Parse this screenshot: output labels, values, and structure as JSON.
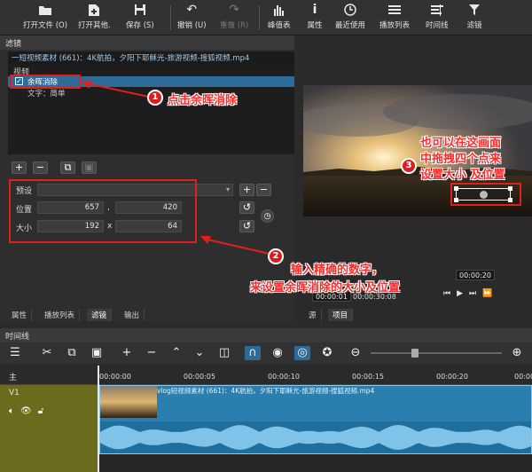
{
  "toolbar": {
    "open_file": "打开文件 (O)",
    "open_other": "打开其他.",
    "save": "保存 (S)",
    "undo": "撤销 (U)",
    "redo": "重做 (R)",
    "peak_meter": "峰值表",
    "properties": "属性",
    "recent": "最近使用",
    "playlist": "播放列表",
    "timeline": "时间线",
    "filters": "滤镜"
  },
  "filters_panel": {
    "title": "滤镜",
    "clip_title": "一短视频素材 (661)：4K航拍，夕阳下耶稣光-旅游视频-搜狐视频.mp4",
    "list_header": "视频",
    "filter_item": "余晖消除",
    "filter_item_checked": true,
    "filter_item2": "文字：简单",
    "preset_label": "预设",
    "position_label": "位置",
    "position_x": "657",
    "position_sep": ",",
    "position_y": "420",
    "size_label": "大小",
    "size_w": "192",
    "size_sep": "x",
    "size_h": "64",
    "tabs": [
      "属性",
      "播放列表",
      "滤镜",
      "输出"
    ]
  },
  "annotations": {
    "one_num": "1",
    "one_text": "点击余晖消除",
    "two_num": "2",
    "two_text_line1": "输入精确的数字，",
    "two_text_line2": "来设置余晖消除的大小及位置",
    "three_num": "3",
    "three_line1": "也可以在这画面",
    "three_line2": "中拖拽四个点来",
    "three_line3": "设置大小 及位置"
  },
  "player": {
    "time_end": "00:00:20",
    "time_current": "00:00:01",
    "time_total": "00:00:30:08",
    "tab_source": "源",
    "tab_project": "项目"
  },
  "timeline": {
    "title": "时间线",
    "master_label": "主",
    "track_label": "V1",
    "ticks": [
      "00:00:00",
      "00:00:05",
      "00:00:10",
      "00:00:15",
      "00:00:20",
      "00:00:25"
    ],
    "clip_label": "vlog短视频素材 (661)：4K航拍，夕阳下耶稣光-旅游视频-搜狐视频.mp4"
  }
}
